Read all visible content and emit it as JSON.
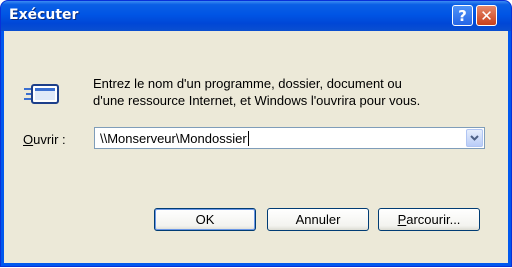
{
  "window": {
    "title": "Exécuter",
    "help_label": "?",
    "close_label": "✕"
  },
  "description": {
    "line1": "Entrez le nom d'un programme, dossier, document ou",
    "line2": "d'une ressource Internet, et Windows l'ouvrira pour vous."
  },
  "open_field": {
    "label_mnemonic": "O",
    "label_rest": "uvrir :",
    "value": "\\\\Monserveur\\Mondossier"
  },
  "buttons": {
    "ok": "OK",
    "cancel": "Annuler",
    "browse_mnemonic": "P",
    "browse_rest": "arcourir..."
  },
  "colors": {
    "titlebar": "#0055e5",
    "client_bg": "#ece9d8",
    "close_button": "#c9401c"
  },
  "icons": {
    "run": "run-program-icon",
    "help": "help-icon",
    "close": "close-icon",
    "dropdown": "chevron-down-icon"
  }
}
